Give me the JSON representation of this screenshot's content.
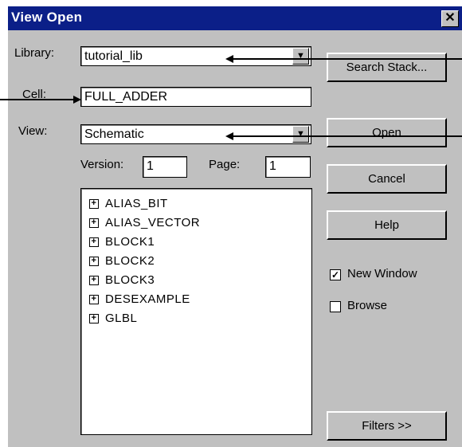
{
  "window": {
    "title": "View Open",
    "close_glyph": "✕"
  },
  "form": {
    "library_label": "Library:",
    "library_value": "tutorial_lib",
    "cell_label": "Cell:",
    "cell_value": "FULL_ADDER",
    "view_label": "View:",
    "view_value": "Schematic",
    "version_label": "Version:",
    "version_value": "1",
    "page_label": "Page:",
    "page_value": "1",
    "dropdown_arrow": "▼"
  },
  "cells": [
    {
      "label": "ALIAS_BIT"
    },
    {
      "label": "ALIAS_VECTOR"
    },
    {
      "label": "BLOCK1"
    },
    {
      "label": "BLOCK2"
    },
    {
      "label": "BLOCK3"
    },
    {
      "label": "DESEXAMPLE"
    },
    {
      "label": "GLBL"
    }
  ],
  "expand_glyph": "+",
  "buttons": {
    "search_stack": "Search Stack...",
    "open": "Open",
    "cancel": "Cancel",
    "help": "Help",
    "filters": "Filters >>"
  },
  "options": {
    "new_window_label": "New Window",
    "new_window_checked": true,
    "browse_label": "Browse",
    "browse_checked": false,
    "check_glyph": "✓"
  },
  "colors": {
    "titlebar": "#0b1f88",
    "dialog": "#c0c0c0"
  }
}
